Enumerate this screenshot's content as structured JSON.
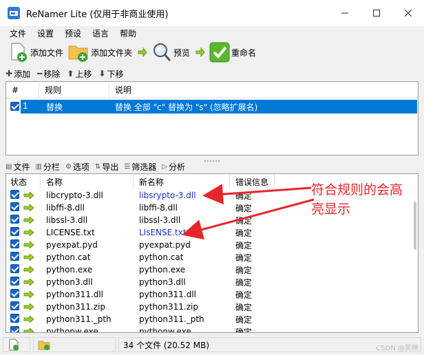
{
  "window": {
    "title": "ReNamer Lite  (仅用于非商业使用)"
  },
  "menu": [
    "文件",
    "设置",
    "预设",
    "语言",
    "帮助"
  ],
  "toolbar": {
    "add_files": "添加文件",
    "add_folder": "添加文件夹",
    "preview": "预览",
    "rename": "重命名"
  },
  "rule_actions": {
    "add": "添加",
    "remove": "移除",
    "up": "上移",
    "down": "下移"
  },
  "rules": {
    "columns": [
      "#",
      "规则",
      "说明"
    ],
    "rows": [
      {
        "num": "1",
        "rule": "替换",
        "desc": "替换 全部 \"c\" 替换为 \"s\" (忽略扩展名)",
        "checked": true
      }
    ]
  },
  "file_actions": [
    "文件",
    "分栏",
    "选项",
    "导出",
    "筛选器",
    "分析"
  ],
  "files": {
    "columns": [
      "状态",
      "名称",
      "新名称",
      "错误信息"
    ],
    "rows": [
      {
        "name": "libcrypto-3.dll",
        "new": "libsrypto-3.dll",
        "err": "确定",
        "hl": true
      },
      {
        "name": "libffi-8.dll",
        "new": "libffi-8.dll",
        "err": "确定",
        "hl": false
      },
      {
        "name": "libssl-3.dll",
        "new": "libssl-3.dll",
        "err": "确定",
        "hl": false
      },
      {
        "name": "LICENSE.txt",
        "new": "LIsENSE.txt",
        "err": "确定",
        "hl": true
      },
      {
        "name": "pyexpat.pyd",
        "new": "pyexpat.pyd",
        "err": "确定",
        "hl": false
      },
      {
        "name": "python.cat",
        "new": "python.cat",
        "err": "确定",
        "hl": false
      },
      {
        "name": "python.exe",
        "new": "python.exe",
        "err": "确定",
        "hl": false
      },
      {
        "name": "python3.dll",
        "new": "python3.dll",
        "err": "确定",
        "hl": false
      },
      {
        "name": "python311.dll",
        "new": "python311.dll",
        "err": "确定",
        "hl": false
      },
      {
        "name": "python311.zip",
        "new": "python311.zip",
        "err": "确定",
        "hl": false
      },
      {
        "name": "python311._pth",
        "new": "python311._pth",
        "err": "确定",
        "hl": false
      },
      {
        "name": "pythonw.exe",
        "new": "pythonw.exe",
        "err": "确定",
        "hl": false
      }
    ]
  },
  "status": {
    "summary": "34 个文件 (20.52 MB)"
  },
  "annotation": {
    "line1": "符合规则的会高",
    "line2": "亮显示"
  },
  "watermark": "CSDN @笑眯",
  "colors": {
    "accent": "#0078d7",
    "highlight_text": "#1a2fd0",
    "annotation": "#e8262a"
  }
}
